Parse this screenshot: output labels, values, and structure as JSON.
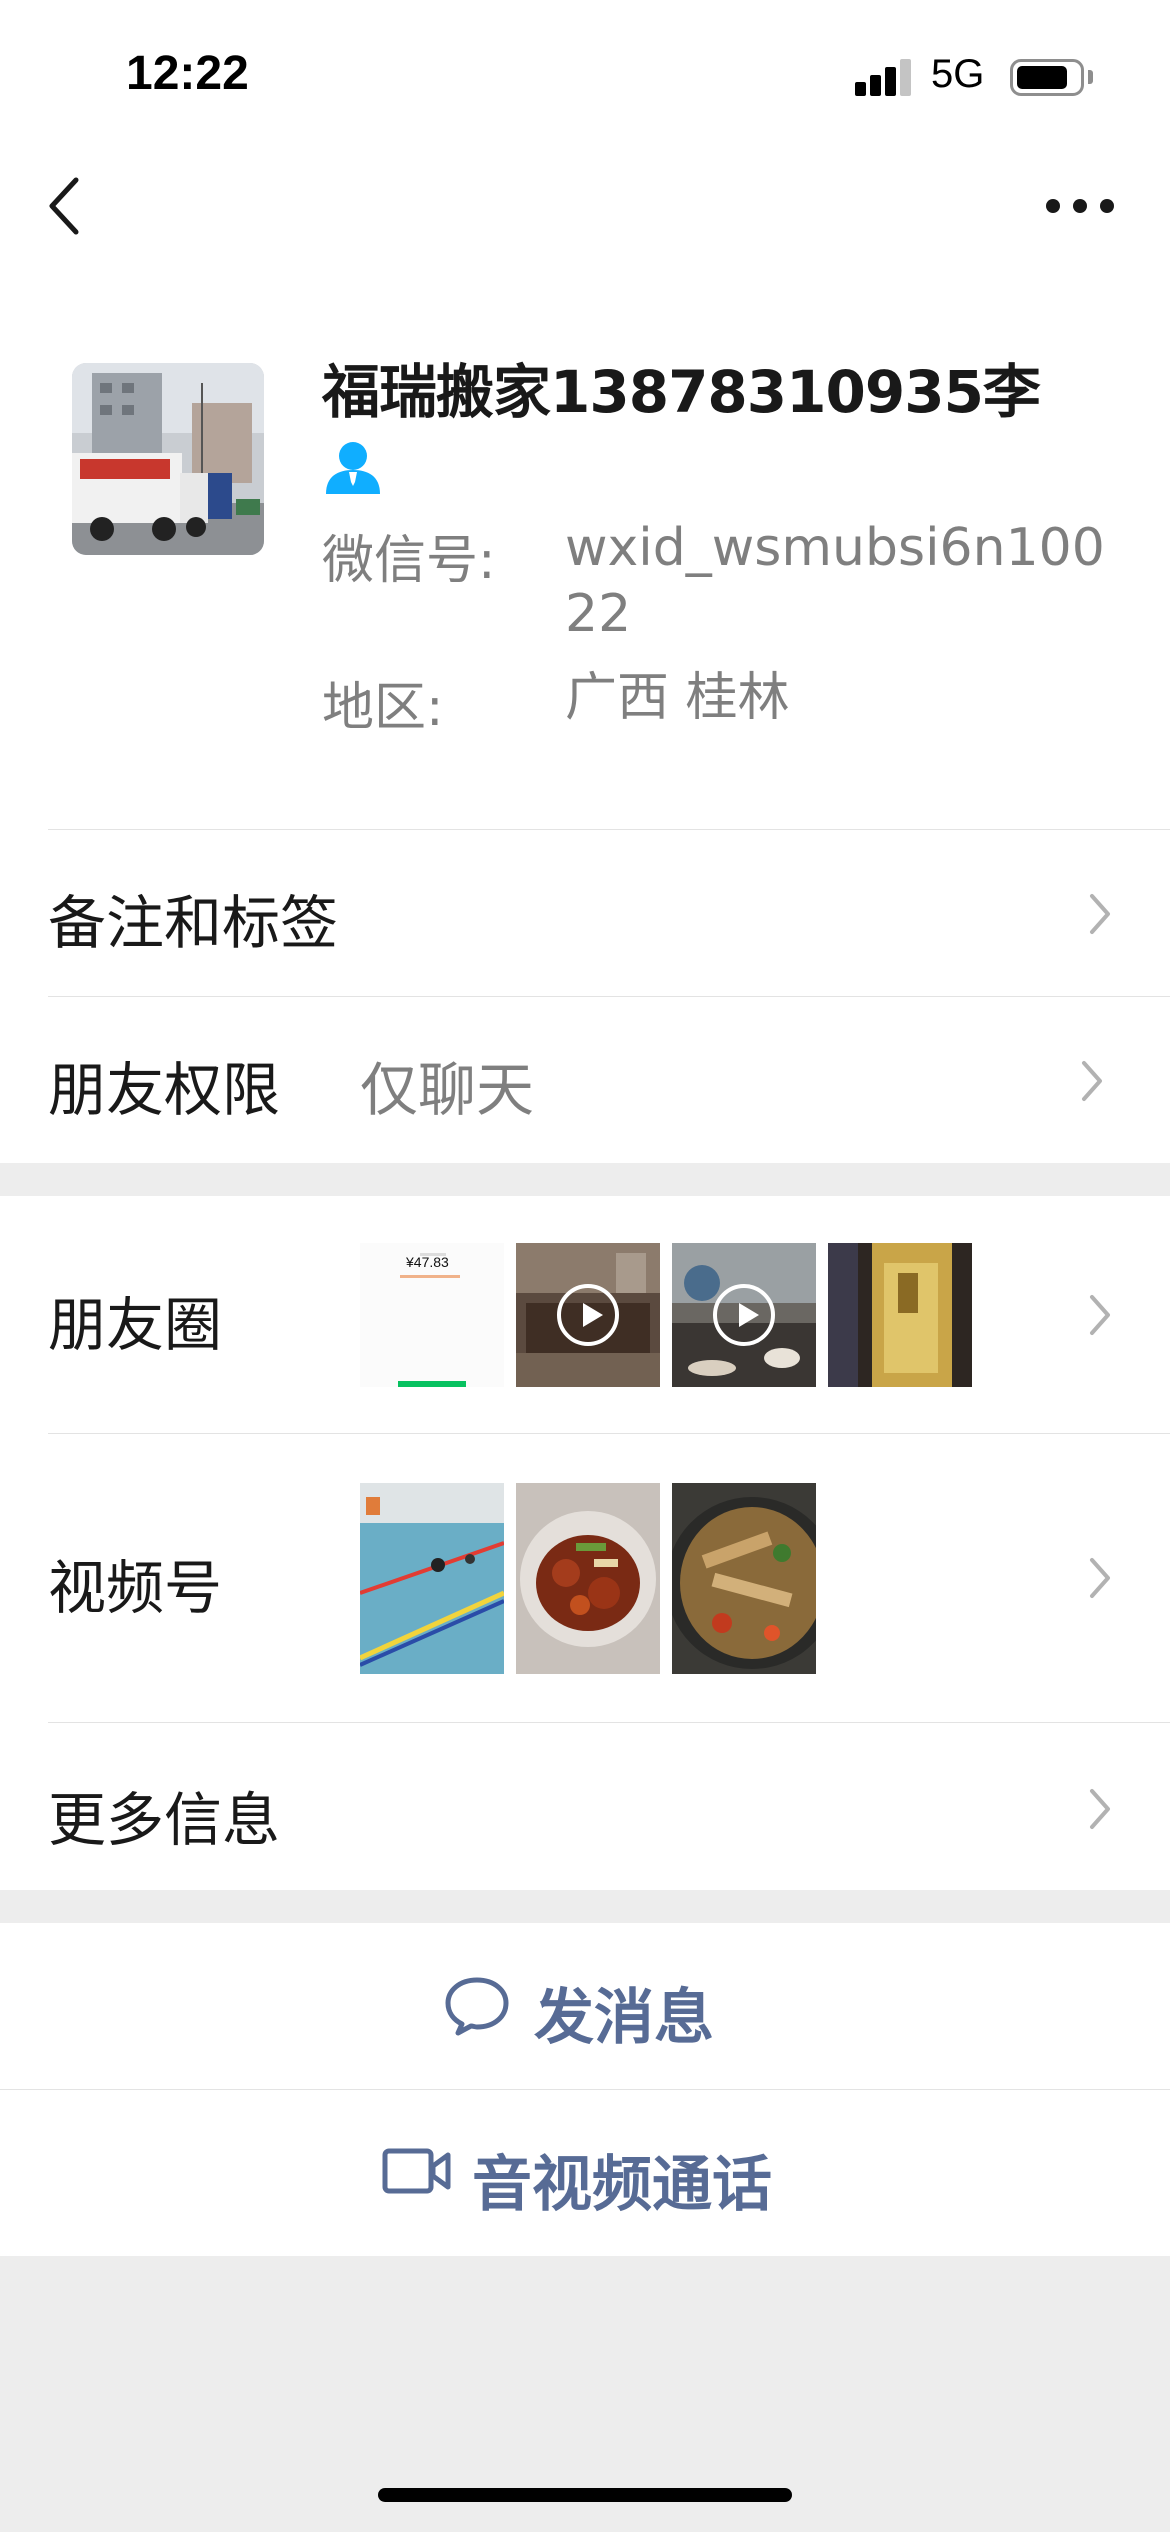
{
  "status_bar": {
    "time": "12:22",
    "network": "5G",
    "battery_level": 0.75,
    "signal_bars": 3
  },
  "nav": {
    "back_icon": "chevron-left-icon",
    "more_icon": "ellipsis-icon"
  },
  "profile": {
    "name": "福瑞搬家13878310935李",
    "wechat_id_label": "微信号:",
    "wechat_id_line1": "wxid_wsmubsi6n100",
    "wechat_id_line2": "22",
    "region_label": "地区:",
    "region_value": "广西 桂林"
  },
  "rows": {
    "remarks": {
      "label": "备注和标签"
    },
    "permissions": {
      "label": "朋友权限",
      "value": "仅聊天"
    },
    "moments": {
      "label": "朋友圈",
      "thumb_text": "¥47.83"
    },
    "channels": {
      "label": "视频号"
    },
    "more_info": {
      "label": "更多信息"
    }
  },
  "actions": {
    "message": {
      "label": "发消息"
    },
    "call": {
      "label": "音视频通话"
    }
  },
  "colors": {
    "accent": "#576b95",
    "background": "#ededed",
    "secondary_text": "#7f7f7f",
    "contact_icon": "#10aeff"
  }
}
